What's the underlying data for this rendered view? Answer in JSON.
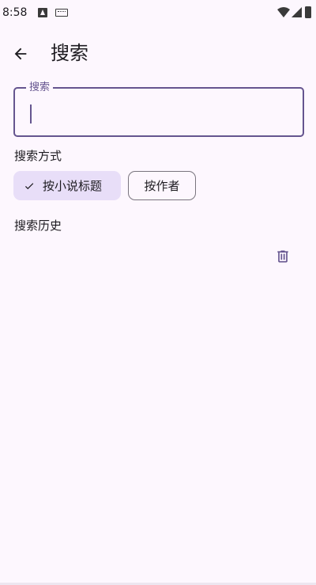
{
  "status_bar": {
    "time": "8:58",
    "icons": [
      "a-notification-icon",
      "keyboard-icon",
      "wifi-icon",
      "signal-icon",
      "battery-icon"
    ]
  },
  "header": {
    "back_icon": "arrow-left-icon",
    "title": "搜索"
  },
  "search": {
    "label": "搜索",
    "value": "",
    "placeholder": ""
  },
  "search_mode": {
    "heading": "搜索方式",
    "options": [
      {
        "label": "按小说标题",
        "selected": true
      },
      {
        "label": "按作者",
        "selected": false
      }
    ]
  },
  "history": {
    "heading": "搜索历史",
    "clear_icon": "trash-icon",
    "items": []
  },
  "colors": {
    "background": "#FDF7FE",
    "accent": "#65558F",
    "chip_selected_bg": "#E8DEF8",
    "outline": "#79747E",
    "text": "#1D1B20"
  }
}
